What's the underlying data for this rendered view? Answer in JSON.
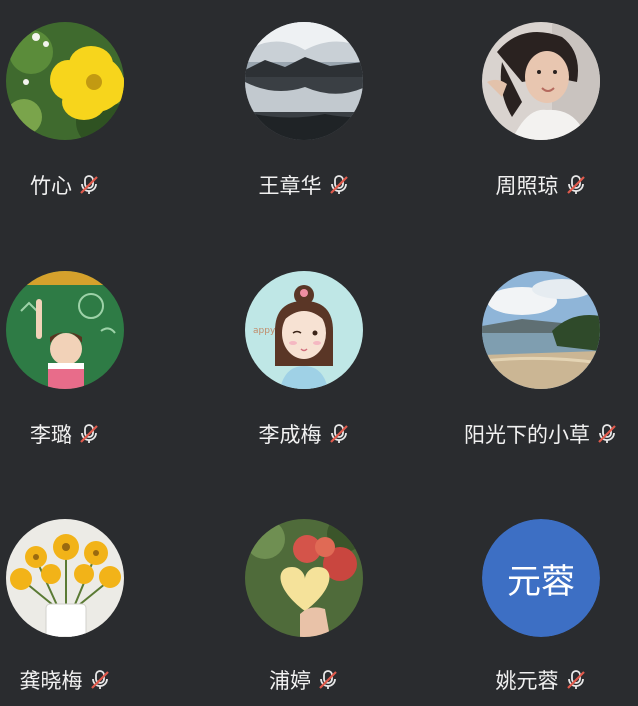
{
  "participants": [
    {
      "name": "竹心",
      "avatar": "yellow-flower-photo",
      "muted": true
    },
    {
      "name": "王章华",
      "avatar": "lake-reflection-photo",
      "muted": true
    },
    {
      "name": "周照琼",
      "avatar": "girl-portrait-photo",
      "muted": true
    },
    {
      "name": "李璐",
      "avatar": "classroom-cartoon",
      "muted": true
    },
    {
      "name": "李成梅",
      "avatar": "cartoon-girl-illustration",
      "muted": true
    },
    {
      "name": "阳光下的小草",
      "avatar": "beach-landscape-photo",
      "muted": true
    },
    {
      "name": "龚晓梅",
      "avatar": "sunflower-vase-photo",
      "muted": true
    },
    {
      "name": "浦婷",
      "avatar": "apples-heart-photo",
      "muted": true
    },
    {
      "name": "姚元蓉",
      "avatar_text": "元蓉",
      "avatar_color": "#3d6fc4",
      "muted": true
    }
  ],
  "colors": {
    "background": "#2a2c2f",
    "muted_icon": "#e05a4c",
    "text": "#f1f1f1"
  }
}
